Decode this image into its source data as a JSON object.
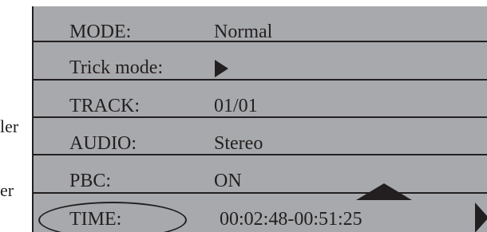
{
  "left_labels": [
    "ler",
    "er"
  ],
  "menu": {
    "rows": [
      {
        "label": "MODE:",
        "value": "Normal"
      },
      {
        "label": "Trick mode:",
        "value_icon": "play-icon"
      },
      {
        "label": "TRACK:",
        "value": "01/01"
      },
      {
        "label": "AUDIO:",
        "value": "Stereo"
      },
      {
        "label": "PBC:",
        "value": "ON"
      },
      {
        "label": "TIME:",
        "value": "00:02:48-00:51:25"
      }
    ],
    "selected_row": "TIME:",
    "icons": [
      "play-icon",
      "up-arrow-icon",
      "right-arrow-icon"
    ],
    "colors": {
      "panel_bg": "#a7a9ac",
      "line": "#231f20",
      "text": "#231f20"
    }
  }
}
